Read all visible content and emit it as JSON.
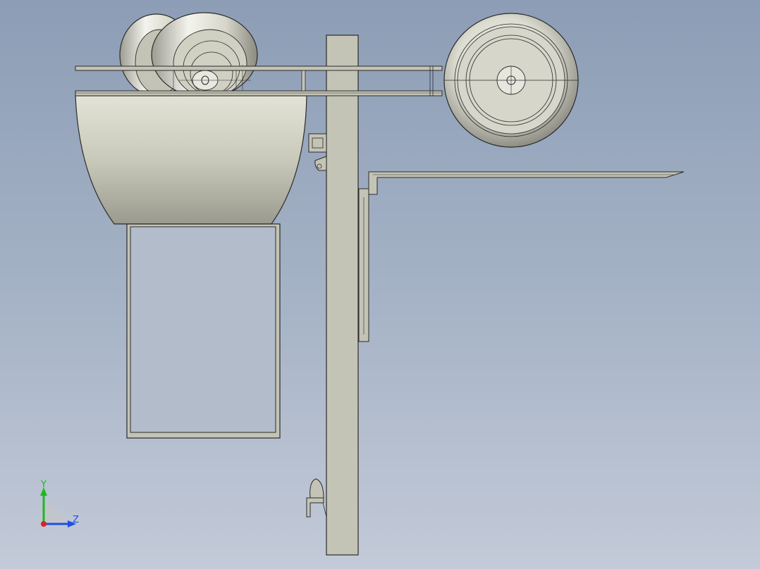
{
  "viewport": {
    "background_top": "#8c9db5",
    "background_bottom": "#c3cad8"
  },
  "model": {
    "part_fill": "#c4c4b6",
    "part_stroke": "#2b2b2b",
    "tire_light": "#f3f3ec",
    "tire_shadow": "#8f8f86"
  },
  "triad": {
    "y_label": "Y",
    "z_label": "Z",
    "y_color": "#1fb81f",
    "z_color": "#2050e0",
    "x_color": "#e02020"
  }
}
